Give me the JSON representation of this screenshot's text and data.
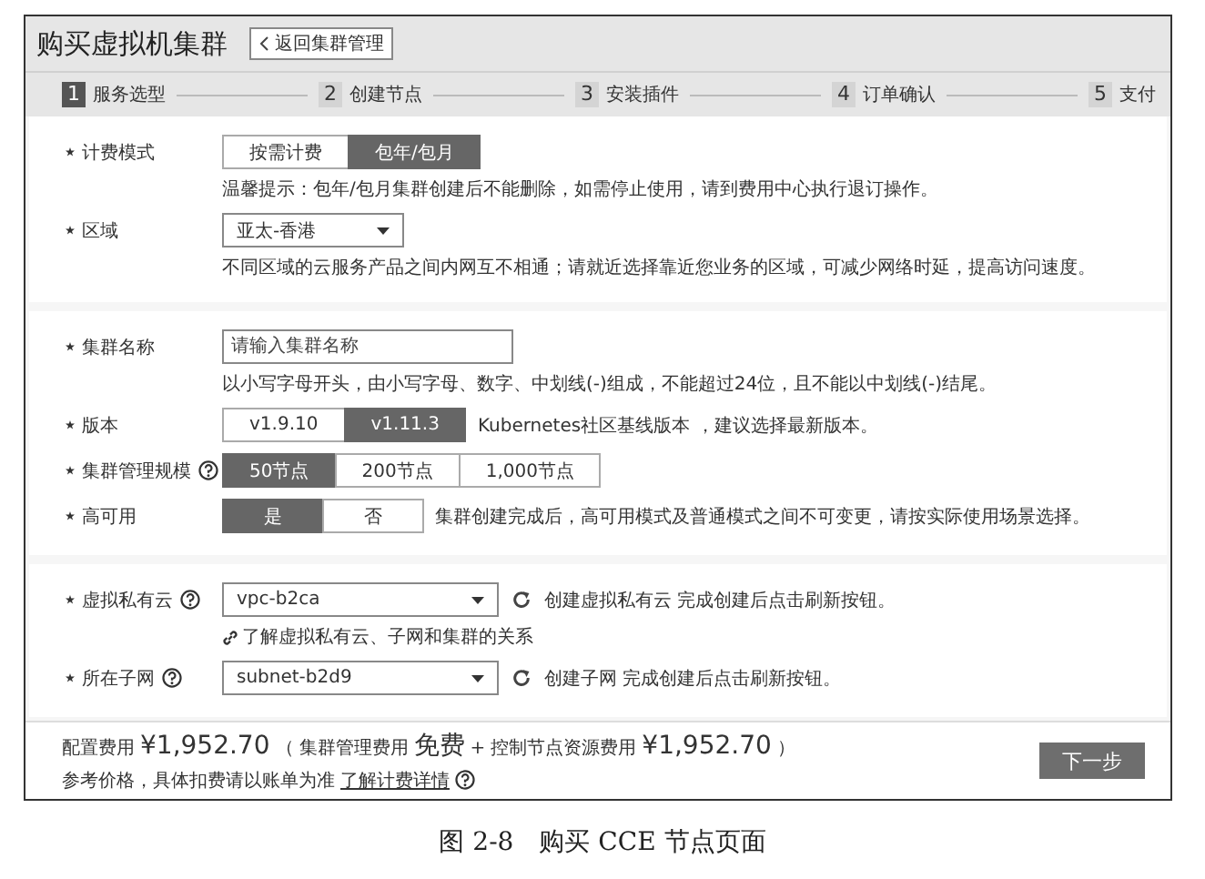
{
  "header": {
    "title": "购买虚拟机集群",
    "back_button": "返回集群管理"
  },
  "steps": [
    {
      "number": "1",
      "label": "服务选型",
      "selected": true
    },
    {
      "number": "2",
      "label": "创建节点",
      "selected": false
    },
    {
      "number": "3",
      "label": "安装插件",
      "selected": false
    },
    {
      "number": "4",
      "label": "订单确认",
      "selected": false
    },
    {
      "number": "5",
      "label": "支付",
      "selected": false
    }
  ],
  "sections": [
    {
      "rows": [
        {
          "kind": "segmented",
          "label": "计费模式",
          "help": false,
          "options": [
            {
              "label": "按需计费",
              "selected": false
            },
            {
              "label": "包年/包月",
              "selected": true
            }
          ],
          "hint": "温馨提示：包年/包月集群创建后不能删除，如需停止使用，请到费用中心执行退订操作。"
        },
        {
          "kind": "select_short",
          "label": "区域",
          "help": false,
          "value": "亚太-香港",
          "hint": "不同区域的云服务产品之间内网互不相通；请就近选择靠近您业务的区域，可减少网络时延，提高访问速度。"
        }
      ]
    },
    {
      "rows": [
        {
          "kind": "input",
          "label": "集群名称",
          "help": false,
          "placeholder": "请输入集群名称",
          "hint": "以小写字母开头，由小写字母、数字、中划线(-)组成，不能超过24位，且不能以中划线(-)结尾。"
        },
        {
          "kind": "segmented",
          "label": "版本",
          "help": false,
          "options": [
            {
              "label": "v1.9.10",
              "selected": false
            },
            {
              "label": "v1.11.3",
              "selected": true
            }
          ],
          "note": "Kubernetes社区基线版本 ，建议选择最新版本。"
        },
        {
          "kind": "segmented",
          "label": "集群管理规模",
          "help": true,
          "options": [
            {
              "label": "50节点",
              "selected": true
            },
            {
              "label": "200节点",
              "selected": false
            },
            {
              "label": "1,000节点",
              "selected": false
            }
          ]
        },
        {
          "kind": "segmented",
          "label": "高可用",
          "help": false,
          "options": [
            {
              "label": "是",
              "selected": true
            },
            {
              "label": "否",
              "selected": false
            }
          ],
          "note": "集群创建完成后，高可用模式及普通模式之间不可变更，请按实际使用场景选择。"
        }
      ]
    },
    {
      "rows": [
        {
          "kind": "select",
          "label": "虚拟私有云",
          "help": true,
          "value": "vpc-b2ca",
          "refresh_note": "创建虚拟私有云 完成创建后点击刷新按钮。",
          "link": "了解虚拟私有云、子网和集群的关系"
        },
        {
          "kind": "select",
          "label": "所在子网",
          "help": true,
          "value": "subnet-b2d9",
          "refresh_note": "创建子网 完成创建后点击刷新按钮。"
        }
      ]
    }
  ],
  "footer": {
    "cost_label": "配置费用",
    "total": "¥1,952.70",
    "open_paren": "（",
    "mgmt_label": "集群管理费用",
    "mgmt_value": "免费",
    "plus": "+",
    "node_label": "控制节点资源费用",
    "node_value": "¥1,952.70",
    "close_paren": "）",
    "note": "参考价格，具体扣费请以账单为准",
    "details_link": "了解计费详情",
    "next_button": "下一步"
  },
  "caption": "图 2-8　购买 CCE 节点页面"
}
